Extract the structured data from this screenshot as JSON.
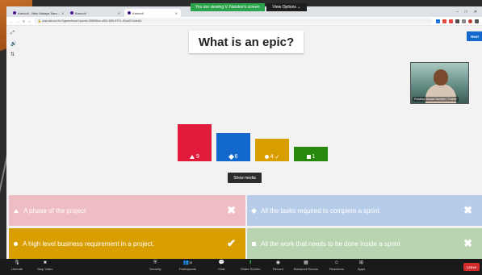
{
  "share_banner": {
    "viewing_text": "You are viewing V. Nandee's screen",
    "options_label": "View Options ⌄"
  },
  "browser": {
    "tabs": [
      {
        "label": "Kahoot! - Nitin Malaya Sam..."
      },
      {
        "label": "Kahoot!"
      },
      {
        "label": "Kahoot!"
      }
    ],
    "url": "play.kahoot.it/v2/gameblock?quizId=3989f6ce-a5f4-48f9-8791-82ad57c4eb84",
    "win_buttons": [
      "–",
      "□",
      "✕"
    ]
  },
  "kahoot": {
    "question": "What is an epic?",
    "next_label": "Next",
    "show_media_label": "Show media",
    "video_name": "Pradeep Kumar Nandee | Trainer",
    "side_icons": [
      "expand-icon",
      "volume-icon",
      "settings-icon"
    ],
    "bars": [
      {
        "shape": "triangle",
        "count": "9",
        "mark": "",
        "color": "#e21b3c",
        "value": 9
      },
      {
        "shape": "diamond",
        "count": "6",
        "mark": "",
        "color": "#1368ce",
        "value": 6
      },
      {
        "shape": "circle",
        "count": "4",
        "mark": "✓",
        "color": "#d89e00",
        "value": 4
      },
      {
        "shape": "square",
        "count": "1",
        "mark": "",
        "color": "#26890c",
        "value": 1
      }
    ],
    "answers": [
      {
        "text": "A phase of the project",
        "shape": "triangle",
        "correct": false,
        "color": "#eebcc3"
      },
      {
        "text": "All the tasks required to complete a sprint",
        "shape": "diamond",
        "correct": false,
        "color": "#b6cce8"
      },
      {
        "text": "A high level business requirement in a project.",
        "shape": "circle",
        "correct": true,
        "color": "#d89e00"
      },
      {
        "text": "All the work that needs to be done inside a sprint",
        "shape": "square",
        "correct": false,
        "color": "#b8d4b0"
      }
    ],
    "wrong_mark": "✖",
    "right_mark": "✔"
  },
  "zoom": {
    "items": [
      {
        "label": "Unmute",
        "icon": "microphone-muted-icon",
        "glyph": "🎙"
      },
      {
        "label": "Stop Video",
        "icon": "video-camera-icon",
        "glyph": "■"
      },
      {
        "label": "Security",
        "icon": "shield-icon",
        "glyph": "⛨"
      },
      {
        "label": "Participants",
        "icon": "participants-icon",
        "glyph": "👥",
        "badge": "28"
      },
      {
        "label": "Chat",
        "icon": "chat-icon",
        "glyph": "💬"
      },
      {
        "label": "Share Screen",
        "icon": "share-screen-icon",
        "glyph": "⬆"
      },
      {
        "label": "Record",
        "icon": "record-icon",
        "glyph": "◉"
      },
      {
        "label": "Breakout Rooms",
        "icon": "breakout-rooms-icon",
        "glyph": "▦"
      },
      {
        "label": "Reactions",
        "icon": "reactions-icon",
        "glyph": "☺"
      },
      {
        "label": "Apps",
        "icon": "apps-icon",
        "glyph": "⊞"
      }
    ],
    "leave_label": "Leave"
  }
}
